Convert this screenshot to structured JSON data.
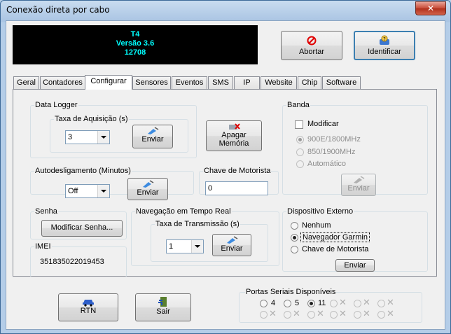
{
  "window": {
    "title": "Conexão direta por cabo",
    "close_icon": "close-icon"
  },
  "display": {
    "line1": "T4",
    "line2": "Versão 3.6",
    "line3": "12708"
  },
  "top_buttons": {
    "abort": "Abortar",
    "identify": "Identificar"
  },
  "tabs": [
    "Geral",
    "Contadores",
    "Configurar",
    "Sensores",
    "Eventos",
    "SMS",
    "IP",
    "Website",
    "Chip",
    "Software"
  ],
  "active_tab": "Configurar",
  "data_logger": {
    "legend": "Data Logger",
    "rate_legend": "Taxa de Aquisição (s)",
    "rate_value": "3",
    "send": "Enviar",
    "clear_line1": "Apagar",
    "clear_line2": "Memória"
  },
  "auto_off": {
    "legend": "Autodesligamento (Minutos)",
    "value": "Off",
    "send": "Enviar"
  },
  "driver_key": {
    "legend": "Chave de Motorista",
    "value": "0"
  },
  "banda": {
    "legend": "Banda",
    "modify": "Modificar",
    "options": [
      "900E/1800MHz",
      "850/1900MHz",
      "Automático"
    ],
    "selected": 0,
    "send": "Enviar"
  },
  "senha": {
    "legend": "Senha",
    "button": "Modificar Senha..."
  },
  "imei": {
    "legend": "IMEI",
    "value": "351835022019453"
  },
  "navegacao": {
    "legend": "Navegação em Tempo Real",
    "rate_legend": "Taxa de Transmissão (s)",
    "rate_value": "1",
    "send": "Enviar"
  },
  "dispositivo": {
    "legend": "Dispositivo Externo",
    "options": [
      "Nenhum",
      "Navegador Garmin",
      "Chave de Motorista"
    ],
    "selected": 1,
    "send": "Enviar"
  },
  "bottom": {
    "rtn": "RTN",
    "exit": "Sair"
  },
  "portas": {
    "legend": "Portas Seriais Disponíveis",
    "ports": [
      "4",
      "5",
      "11"
    ],
    "selected": "11"
  },
  "colors": {
    "display_bg": "#000000",
    "display_text": "#00ffff",
    "title_bar": "#b4cde8"
  }
}
